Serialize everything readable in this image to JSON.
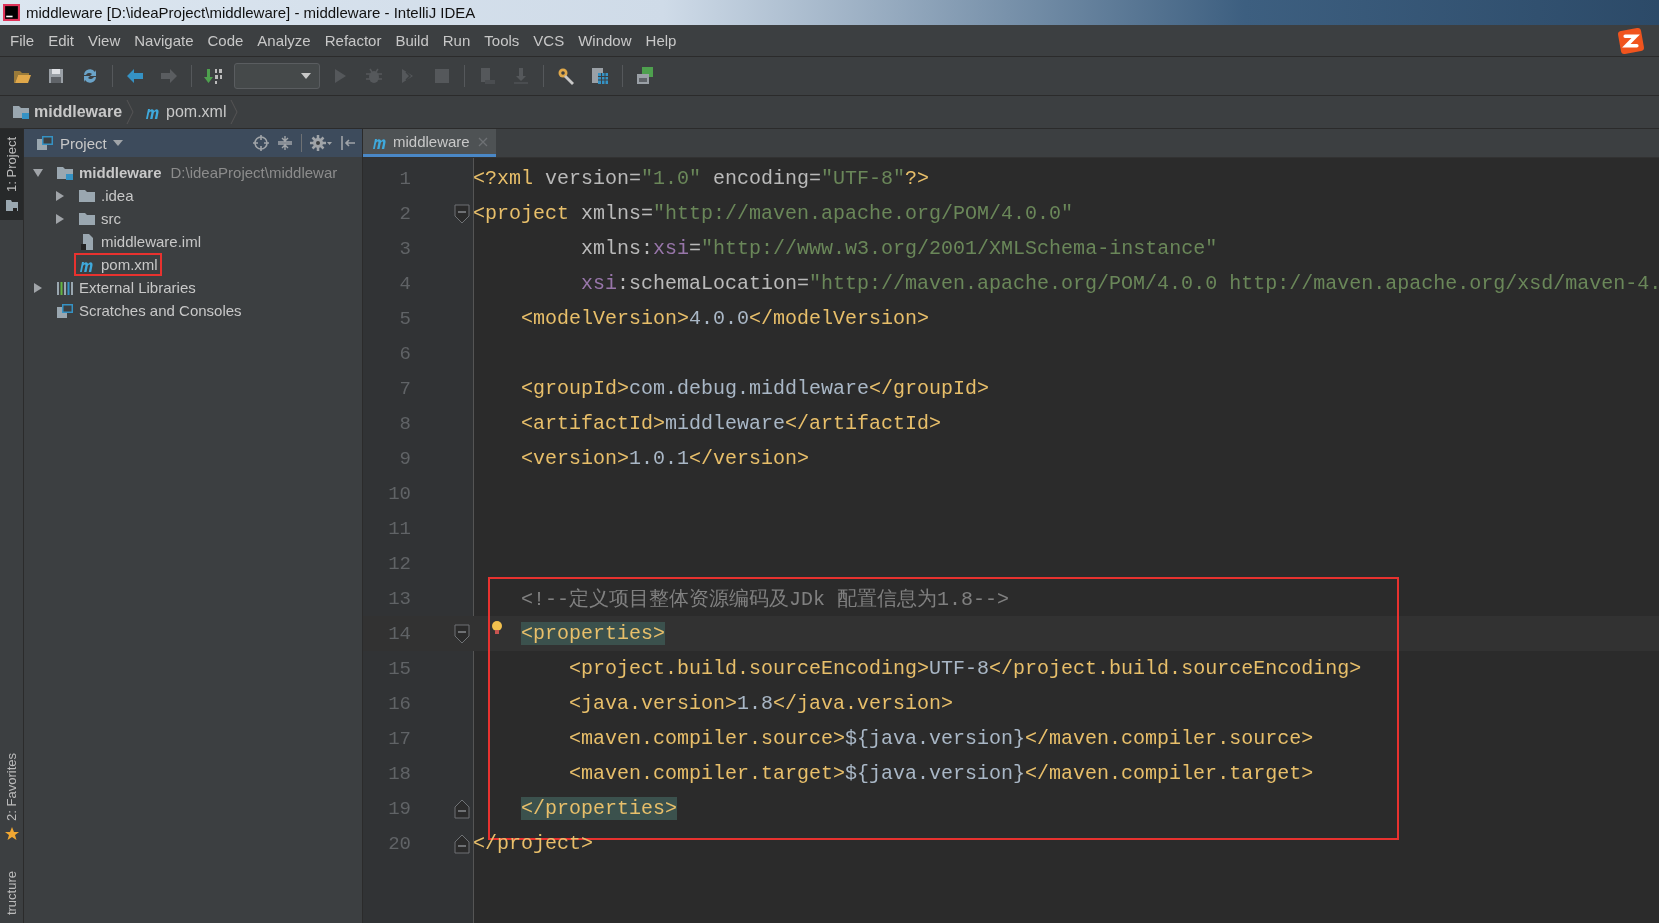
{
  "window": {
    "title": "middleware [D:\\ideaProject\\middleware] - middleware - IntelliJ IDEA"
  },
  "menu": [
    "File",
    "Edit",
    "View",
    "Navigate",
    "Code",
    "Analyze",
    "Refactor",
    "Build",
    "Run",
    "Tools",
    "VCS",
    "Window",
    "Help"
  ],
  "toolbar": [
    {
      "kind": "open",
      "disabled": false
    },
    {
      "kind": "save",
      "disabled": false
    },
    {
      "kind": "sync",
      "disabled": false
    },
    {
      "kind": "sep"
    },
    {
      "kind": "back",
      "disabled": false
    },
    {
      "kind": "forward",
      "disabled": true
    },
    {
      "kind": "sep"
    },
    {
      "kind": "build",
      "disabled": false
    },
    {
      "kind": "config",
      "disabled": false
    },
    {
      "kind": "run",
      "disabled": true
    },
    {
      "kind": "debug",
      "disabled": true
    },
    {
      "kind": "coverage",
      "disabled": true
    },
    {
      "kind": "stop",
      "disabled": true
    },
    {
      "kind": "sep"
    },
    {
      "kind": "attach",
      "disabled": true
    },
    {
      "kind": "download",
      "disabled": true
    },
    {
      "kind": "sep"
    },
    {
      "kind": "settings",
      "disabled": false
    },
    {
      "kind": "structure",
      "disabled": false
    },
    {
      "kind": "sep"
    },
    {
      "kind": "sdk",
      "disabled": false
    }
  ],
  "breadcrumb": [
    {
      "kind": "project",
      "label": "middleware"
    },
    {
      "kind": "maven",
      "label": "pom.xml"
    }
  ],
  "side_tabs": {
    "top": [
      {
        "label": "1: Project",
        "kind": "project",
        "selected": true
      }
    ],
    "bottom": [
      {
        "label": "2: Favorites",
        "kind": "favorites",
        "selected": false
      },
      {
        "label": "tructure",
        "kind": "structure",
        "selected": false
      }
    ]
  },
  "project_panel": {
    "title": "Project",
    "tree": [
      {
        "kind": "project",
        "label": "middleware",
        "path": "D:\\ideaProject\\middlewar",
        "expanded": true,
        "annotated": false,
        "children": [
          {
            "kind": "folder",
            "label": ".idea",
            "expanded": false,
            "annotated": false
          },
          {
            "kind": "folder",
            "label": "src",
            "expanded": false,
            "annotated": false
          },
          {
            "kind": "file",
            "label": "middleware.iml",
            "annotated": false
          },
          {
            "kind": "maven",
            "label": "pom.xml",
            "annotated": true
          }
        ]
      },
      {
        "kind": "libraries",
        "label": "External Libraries",
        "expanded": false,
        "annotated": false
      },
      {
        "kind": "scratches",
        "label": "Scratches and Consoles",
        "annotated": false
      }
    ]
  },
  "editor": {
    "tabs": [
      {
        "label": "middleware",
        "kind": "maven",
        "selected": true
      }
    ],
    "blocks": [
      {
        "annotated": false,
        "lines": [
          {
            "number": "1",
            "current": false,
            "kind": "plain",
            "segments": [
              {
                "kind": "tag",
                "text": "<?xml"
              },
              {
                "kind": "attr",
                "text": " version="
              },
              {
                "kind": "value",
                "text": "\"1.0\""
              },
              {
                "kind": "attr",
                "text": " encoding="
              },
              {
                "kind": "value",
                "text": "\"UTF-8\""
              },
              {
                "kind": "tag",
                "text": "?>"
              }
            ]
          },
          {
            "number": "2",
            "current": false,
            "kind": "fold-start",
            "segments": [
              {
                "kind": "tag",
                "text": "<project"
              },
              {
                "kind": "attr",
                "text": " xmlns="
              },
              {
                "kind": "value",
                "text": "\"http://maven.apache.org/POM/4.0.0\""
              }
            ]
          },
          {
            "number": "3",
            "current": false,
            "kind": "plain",
            "segments": [
              {
                "kind": "attr",
                "text": "         xmlns:"
              },
              {
                "kind": "ns",
                "text": "xsi"
              },
              {
                "kind": "attr",
                "text": "="
              },
              {
                "kind": "value",
                "text": "\"http://www.w3.org/2001/XMLSchema-instance\""
              }
            ]
          },
          {
            "number": "4",
            "current": false,
            "kind": "plain",
            "segments": [
              {
                "kind": "ns",
                "text": "         xsi"
              },
              {
                "kind": "attr",
                "text": ":schemaLocation="
              },
              {
                "kind": "value",
                "text": "\"http://maven.apache.org/POM/4.0.0 http://maven.apache.org/xsd/maven-4."
              }
            ]
          },
          {
            "number": "5",
            "current": false,
            "kind": "plain",
            "segments": [
              {
                "kind": "tag",
                "text": "    <modelVersion>"
              },
              {
                "kind": "text",
                "text": "4.0.0"
              },
              {
                "kind": "tag",
                "text": "</modelVersion>"
              }
            ]
          },
          {
            "number": "6",
            "current": false,
            "kind": "plain"
          },
          {
            "number": "7",
            "current": false,
            "kind": "plain",
            "segments": [
              {
                "kind": "tag",
                "text": "    <groupId>"
              },
              {
                "kind": "text",
                "text": "com.debug.middleware"
              },
              {
                "kind": "tag",
                "text": "</groupId>"
              }
            ]
          },
          {
            "number": "8",
            "current": false,
            "kind": "plain",
            "segments": [
              {
                "kind": "tag",
                "text": "    <artifactId>"
              },
              {
                "kind": "text",
                "text": "middleware"
              },
              {
                "kind": "tag",
                "text": "</artifactId>"
              }
            ]
          },
          {
            "number": "9",
            "current": false,
            "kind": "plain",
            "segments": [
              {
                "kind": "tag",
                "text": "    <version>"
              },
              {
                "kind": "text",
                "text": "1.0.1"
              },
              {
                "kind": "tag",
                "text": "</version>"
              }
            ]
          },
          {
            "number": "10",
            "current": false,
            "kind": "plain"
          },
          {
            "number": "11",
            "current": false,
            "kind": "plain"
          },
          {
            "number": "12",
            "current": false,
            "kind": "plain"
          }
        ]
      },
      {
        "annotated": true,
        "lines": [
          {
            "number": "13",
            "current": false,
            "kind": "plain",
            "segments": [
              {
                "kind": "comment",
                "text": "    <!--定义项目整体资源编码及JDk 配置信息为1.8-->"
              }
            ]
          },
          {
            "number": "14",
            "current": true,
            "kind": "fold-start",
            "bulb": true,
            "segments": [
              {
                "kind": "match",
                "text": "    <properties>"
              }
            ]
          },
          {
            "number": "15",
            "current": false,
            "kind": "plain",
            "segments": [
              {
                "kind": "tag",
                "text": "        <project.build.sourceEncoding>"
              },
              {
                "kind": "text",
                "text": "UTF-8"
              },
              {
                "kind": "tag",
                "text": "</project.build.sourceEncoding>"
              }
            ]
          },
          {
            "number": "16",
            "current": false,
            "kind": "plain",
            "segments": [
              {
                "kind": "tag",
                "text": "        <java.version>"
              },
              {
                "kind": "text",
                "text": "1.8"
              },
              {
                "kind": "tag",
                "text": "</java.version>"
              }
            ]
          },
          {
            "number": "17",
            "current": false,
            "kind": "plain",
            "segments": [
              {
                "kind": "tag",
                "text": "        <maven.compiler.source>"
              },
              {
                "kind": "text",
                "text": "${java.version}"
              },
              {
                "kind": "tag",
                "text": "</maven.compiler.source>"
              }
            ]
          },
          {
            "number": "18",
            "current": false,
            "kind": "plain",
            "segments": [
              {
                "kind": "tag",
                "text": "        <maven.compiler.target>"
              },
              {
                "kind": "text",
                "text": "${java.version}"
              },
              {
                "kind": "tag",
                "text": "</maven.compiler.target>"
              }
            ]
          },
          {
            "number": "19",
            "current": false,
            "kind": "fold-end",
            "segments": [
              {
                "kind": "match",
                "text": "    </properties>"
              }
            ]
          }
        ]
      },
      {
        "annotated": false,
        "lines": [
          {
            "number": "20",
            "current": false,
            "kind": "fold-end",
            "segments": [
              {
                "kind": "tag",
                "text": "</project>"
              }
            ]
          }
        ]
      }
    ]
  }
}
